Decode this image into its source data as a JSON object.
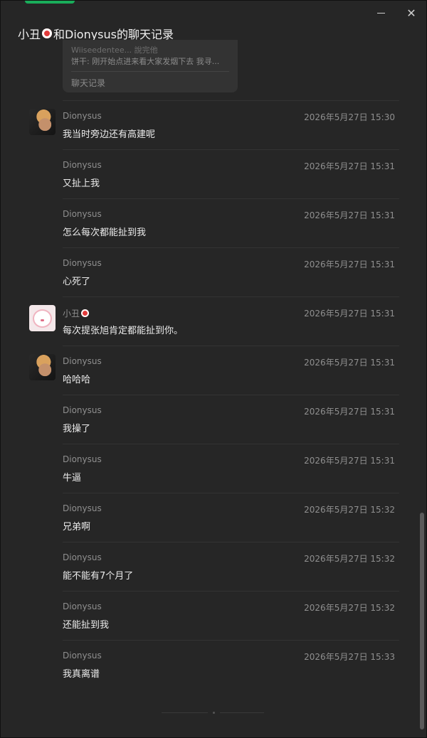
{
  "window": {
    "title_prefix": "小丑",
    "title_suffix": "和Dionysus的聊天记录",
    "minimize_icon": "minimize-icon",
    "close_icon": "close-icon",
    "close_glyph": "✕"
  },
  "forward_card": {
    "line1": "Wiiseedentee... 說完他",
    "line2": "饼干: 刚开始点进来看大家发烟下去 我寻...",
    "footer": "聊天记录"
  },
  "messages": [
    {
      "sender": "Dionysus",
      "time": "2026年5月27日 15:30",
      "text": "我当时旁边还有高建呢",
      "avatar": "dionysus-avatar"
    },
    {
      "sender": "Dionysus",
      "time": "2026年5月27日 15:31",
      "text": "又扯上我",
      "avatar": ""
    },
    {
      "sender": "Dionysus",
      "time": "2026年5月27日 15:31",
      "text": "怎么每次都能扯到我",
      "avatar": ""
    },
    {
      "sender": "Dionysus",
      "time": "2026年5月27日 15:31",
      "text": "心死了",
      "avatar": ""
    },
    {
      "sender": "小丑",
      "time": "2026年5月27日 15:31",
      "text": "每次提张旭肯定都能扯到你。",
      "avatar": "clown-avatar"
    },
    {
      "sender": "Dionysus",
      "time": "2026年5月27日 15:31",
      "text": "哈哈哈",
      "avatar": "dionysus-avatar"
    },
    {
      "sender": "Dionysus",
      "time": "2026年5月27日 15:31",
      "text": "我操了",
      "avatar": ""
    },
    {
      "sender": "Dionysus",
      "time": "2026年5月27日 15:31",
      "text": "牛逼",
      "avatar": ""
    },
    {
      "sender": "Dionysus",
      "time": "2026年5月27日 15:32",
      "text": "兄弟啊",
      "avatar": ""
    },
    {
      "sender": "Dionysus",
      "time": "2026年5月27日 15:32",
      "text": "能不能有7个月了",
      "avatar": ""
    },
    {
      "sender": "Dionysus",
      "time": "2026年5月27日 15:32",
      "text": "还能扯到我",
      "avatar": ""
    },
    {
      "sender": "Dionysus",
      "time": "2026年5月27日 15:33",
      "text": "我真离谱",
      "avatar": ""
    }
  ],
  "colors": {
    "background": "#262626",
    "accent": "#1aad5a",
    "meta_text": "#8f8f8f"
  }
}
